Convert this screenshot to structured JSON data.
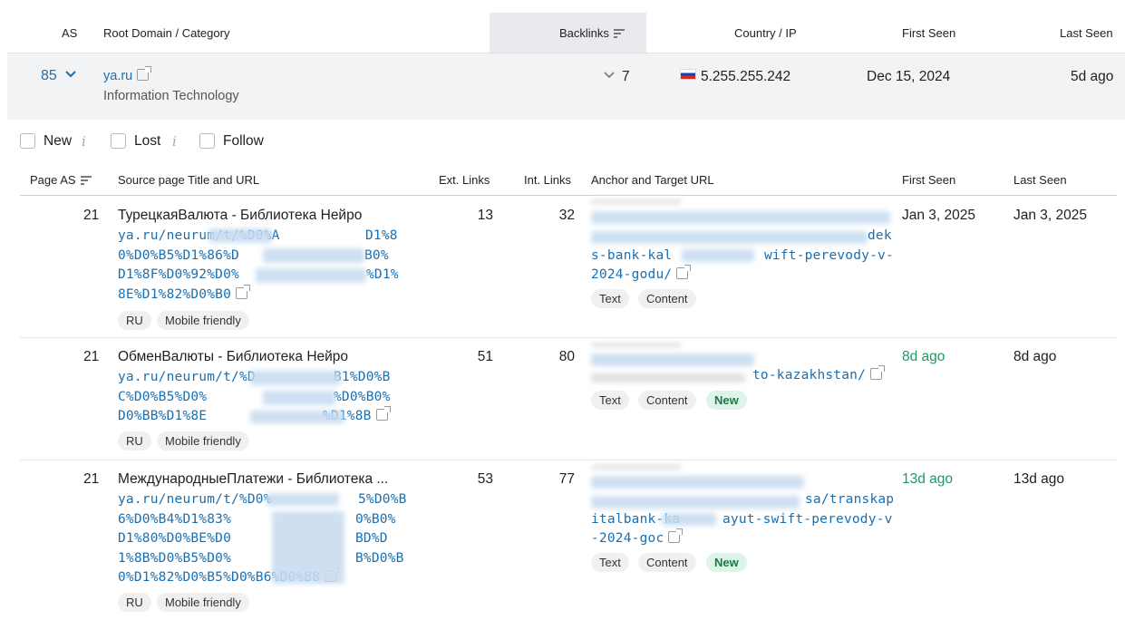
{
  "top_header": {
    "as": "AS",
    "root_domain": "Root Domain / Category",
    "backlinks": "Backlinks",
    "country_ip": "Country / IP",
    "first_seen": "First Seen",
    "last_seen": "Last Seen"
  },
  "domain_row": {
    "as_value": "85",
    "domain": "ya.ru",
    "category": "Information Technology",
    "backlinks": "7",
    "ip": "5.255.255.242",
    "first_seen": "Dec 15, 2024",
    "last_seen": "5d ago"
  },
  "filters": {
    "new": "New",
    "lost": "Lost",
    "follow": "Follow",
    "info_glyph": "i"
  },
  "sub_header": {
    "page_as": "Page AS",
    "source": "Source page Title and URL",
    "ext_links": "Ext. Links",
    "int_links": "Int. Links",
    "anchor": "Anchor and Target URL",
    "first_seen": "First Seen",
    "last_seen": "Last Seen"
  },
  "rows": [
    {
      "page_as": "21",
      "title": "ТурецкаяВалюта - Библиотека Нейро",
      "url_lines": [
        "ya.ru/neurum/t/%D0%A",
        "D1%8",
        "0%D0%B5%D1%86%D",
        "B0%",
        "D1%8F%D0%92%D0%",
        "%D1%",
        "8E%D1%82%D0%B0"
      ],
      "tags": [
        "RU",
        "Mobile friendly"
      ],
      "ext_links": "13",
      "int_links": "32",
      "anchor_lines": [
        "dek",
        "s-bank-kal",
        "wift-perevody-v-",
        "2024-godu/"
      ],
      "anchor_tags": [
        "Text",
        "Content"
      ],
      "first_seen": "Jan 3, 2025",
      "last_seen": "Jan 3, 2025"
    },
    {
      "page_as": "21",
      "title": "ОбменВалюты - Библиотека Нейро",
      "url_lines": [
        "ya.ru/neurum/t/%D",
        "B1%D0%B",
        "C%D0%B5%D0%",
        "%D0%B0%",
        "D0%BB%D1%8E",
        "%D1%8B"
      ],
      "tags": [
        "RU",
        "Mobile friendly"
      ],
      "ext_links": "51",
      "int_links": "80",
      "anchor_lines": [
        "to-kazakhstan/"
      ],
      "anchor_tags": [
        "Text",
        "Content",
        "New"
      ],
      "first_seen": "8d ago",
      "last_seen": "8d ago"
    },
    {
      "page_as": "21",
      "title": "МеждународныеПлатежи - Библиотека ...",
      "url_lines": [
        "ya.ru/neurum/t/%D0%",
        "5%D0%B",
        "6%D0%B4%D1%83%",
        "0%B0%",
        "D1%80%D0%BE%D0",
        "BD%D",
        "1%8B%D0%B5%D0%",
        "B%D0%B",
        "0%D1%82%D0%B5%D0%B6%D0%B8"
      ],
      "tags": [
        "RU",
        "Mobile friendly"
      ],
      "ext_links": "53",
      "int_links": "77",
      "anchor_lines": [
        "sa/transkap",
        "italbank-ka",
        "ayut-swift-perevody-v",
        "-2024-goc"
      ],
      "anchor_tags": [
        "Text",
        "Content",
        "New"
      ],
      "first_seen": "13d ago",
      "last_seen": "13d ago"
    }
  ],
  "colors": {
    "link": "#1a6fb0",
    "green": "#1a9a63",
    "row_bg": "#f2f3f4",
    "sorted_col_bg": "#e8eaed"
  },
  "icons": [
    "chevron-down-icon",
    "external-link-icon",
    "sort-icon",
    "russia-flag-icon",
    "info-icon",
    "checkbox"
  ]
}
